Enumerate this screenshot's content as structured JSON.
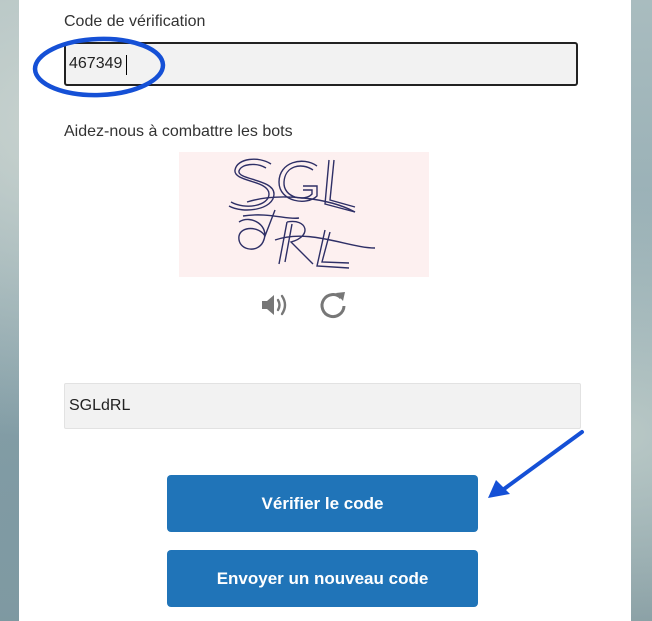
{
  "verification": {
    "label": "Code de vérification",
    "value": "467349"
  },
  "captcha": {
    "label": "Aidez-nous à combattre les bots",
    "image_text": "SGLdRL",
    "audio_icon": "speaker-icon",
    "refresh_icon": "refresh-icon",
    "input_value": "SGLdRL"
  },
  "buttons": {
    "verify_label": "Vérifier le code",
    "resend_label": "Envoyer un nouveau code"
  },
  "colors": {
    "primary_button": "#2074b8",
    "annotation_blue": "#1550d6",
    "input_background": "#f2f2f2"
  },
  "annotations": {
    "circle_target": "verification-code-input",
    "arrow_target": "verify-code-button"
  }
}
